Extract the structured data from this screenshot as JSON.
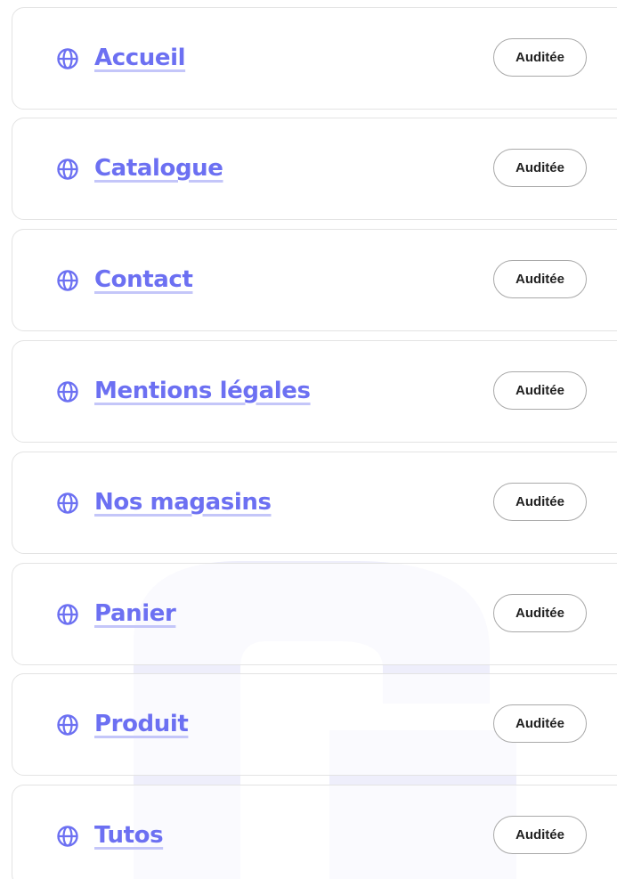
{
  "pages": [
    {
      "name": "Accueil",
      "status": "Auditée"
    },
    {
      "name": "Catalogue",
      "status": "Auditée"
    },
    {
      "name": "Contact",
      "status": "Auditée"
    },
    {
      "name": "Mentions légales",
      "status": "Auditée"
    },
    {
      "name": "Nos magasins",
      "status": "Auditée"
    },
    {
      "name": "Panier",
      "status": "Auditée"
    },
    {
      "name": "Produit",
      "status": "Auditée"
    },
    {
      "name": "Tutos",
      "status": "Auditée"
    }
  ],
  "icon": "globe-icon",
  "colors": {
    "link": "#6c70f2",
    "underline": "#c4c6f9",
    "badge_border": "#a9a9a9",
    "badge_text": "#222222",
    "card_border": "#e3e3e3",
    "watermark": "#eeeefb"
  }
}
